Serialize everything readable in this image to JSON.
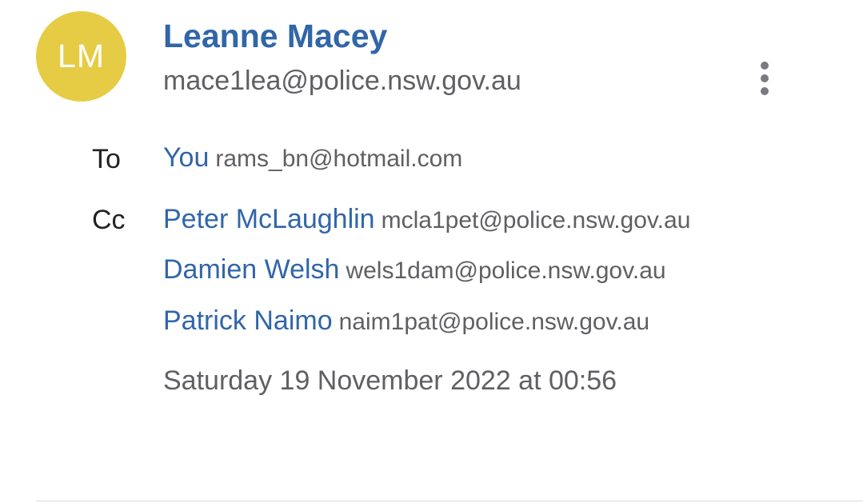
{
  "sender": {
    "initials": "LM",
    "name": "Leanne Macey",
    "email": "mace1lea@police.nsw.gov.au",
    "avatar_color": "#e6cc44"
  },
  "menu": {
    "icon": "more-vert-icon"
  },
  "to": {
    "label": "To",
    "recipients": [
      {
        "name": "You",
        "email": "rams_bn@hotmail.com"
      }
    ]
  },
  "cc": {
    "label": "Cc",
    "recipients": [
      {
        "name": "Peter McLaughlin",
        "email": "mcla1pet@police.nsw.gov.au"
      },
      {
        "name": "Damien Welsh",
        "email": "wels1dam@police.nsw.gov.au"
      },
      {
        "name": "Patrick Naimo",
        "email": "naim1pat@police.nsw.gov.au"
      }
    ]
  },
  "date": "Saturday 19 November 2022 at 00:56",
  "colors": {
    "link": "#3166a8",
    "secondary_text": "#5f6063"
  }
}
